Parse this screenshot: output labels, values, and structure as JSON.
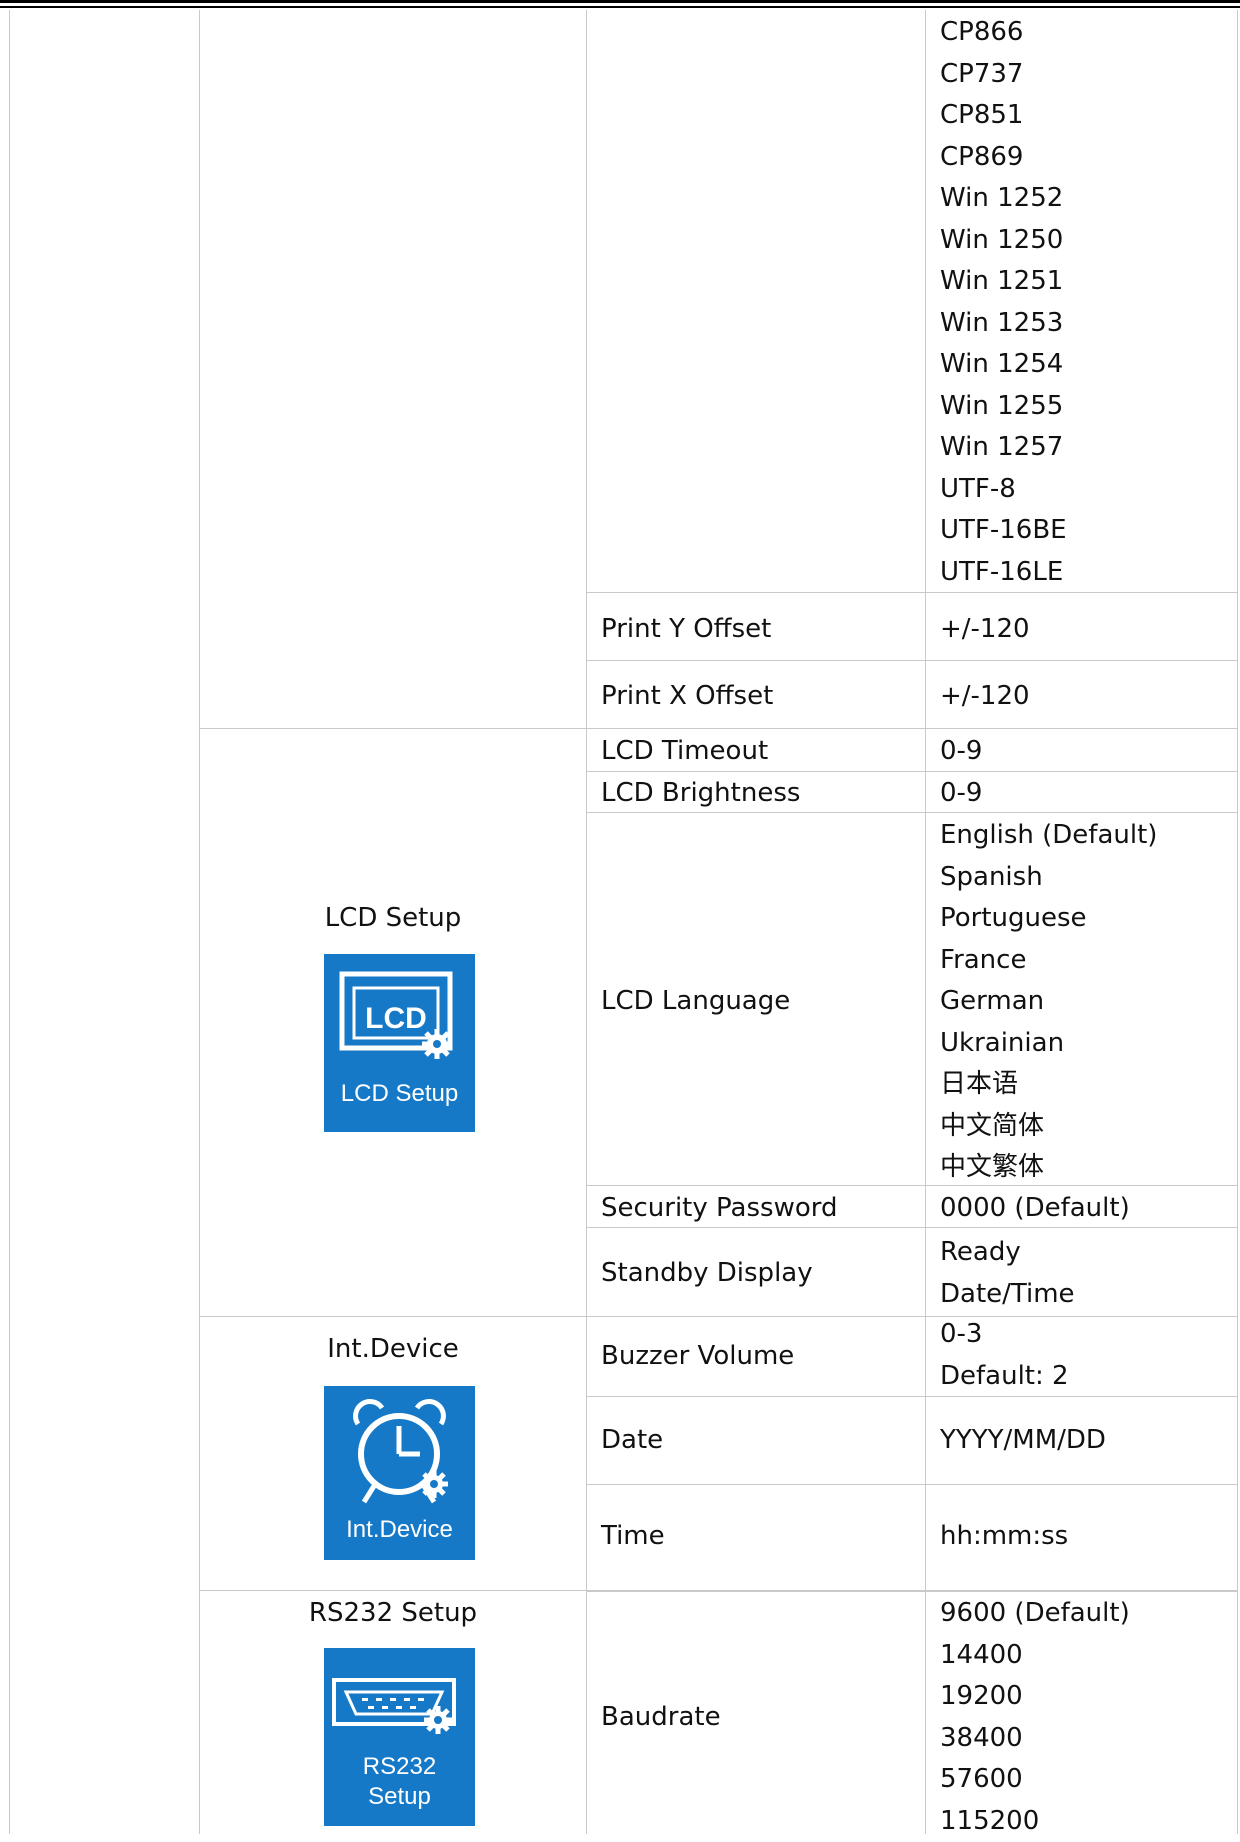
{
  "encodings": [
    "CP866",
    "CP737",
    "CP851",
    "CP869",
    "Win 1252",
    "Win 1250",
    "Win 1251",
    "Win 1253",
    "Win 1254",
    "Win 1255",
    "Win 1257",
    "UTF-8",
    "UTF-16BE",
    "UTF-16LE"
  ],
  "print_y": {
    "label": "Print Y Offset",
    "value": "+/-120"
  },
  "print_x": {
    "label": "Print X Offset",
    "value": "+/-120"
  },
  "lcd_setup": {
    "title": "LCD Setup",
    "icon": {
      "name": "lcd-setup-icon",
      "text": "LCD",
      "caption": "LCD Setup"
    },
    "timeout": {
      "label": "LCD Timeout",
      "value": "0-9"
    },
    "brightness": {
      "label": "LCD Brightness",
      "value": "0-9"
    },
    "language": {
      "label": "LCD Language",
      "values": [
        "English (Default)",
        "Spanish",
        "Portuguese",
        "France",
        "German",
        "Ukrainian",
        "日本语",
        "中文简体",
        "中文繁体"
      ]
    },
    "password": {
      "label": "Security Password",
      "value": "0000 (Default)"
    },
    "standby": {
      "label": "Standby Display",
      "values": [
        "Ready",
        "Date/Time"
      ]
    }
  },
  "int_device": {
    "title": "Int.Device",
    "icon": {
      "name": "alarm-clock-gear-icon",
      "caption": "Int.Device"
    },
    "buzzer": {
      "label": "Buzzer Volume",
      "values": [
        "0-3",
        "Default: 2"
      ]
    },
    "date": {
      "label": "Date",
      "value": "YYYY/MM/DD"
    },
    "time": {
      "label": "Time",
      "value": "hh:mm:ss"
    }
  },
  "rs232_setup": {
    "title": "RS232 Setup",
    "icon": {
      "name": "serial-port-gear-icon",
      "caption_line1": "RS232",
      "caption_line2": "Setup"
    },
    "baudrate": {
      "label": "Baudrate",
      "values": [
        "9600 (Default)",
        "14400",
        "19200",
        "38400",
        "57600",
        "115200"
      ]
    }
  },
  "colors": {
    "icon_bg": "#1579c7",
    "grid": "#c9c9c9"
  }
}
